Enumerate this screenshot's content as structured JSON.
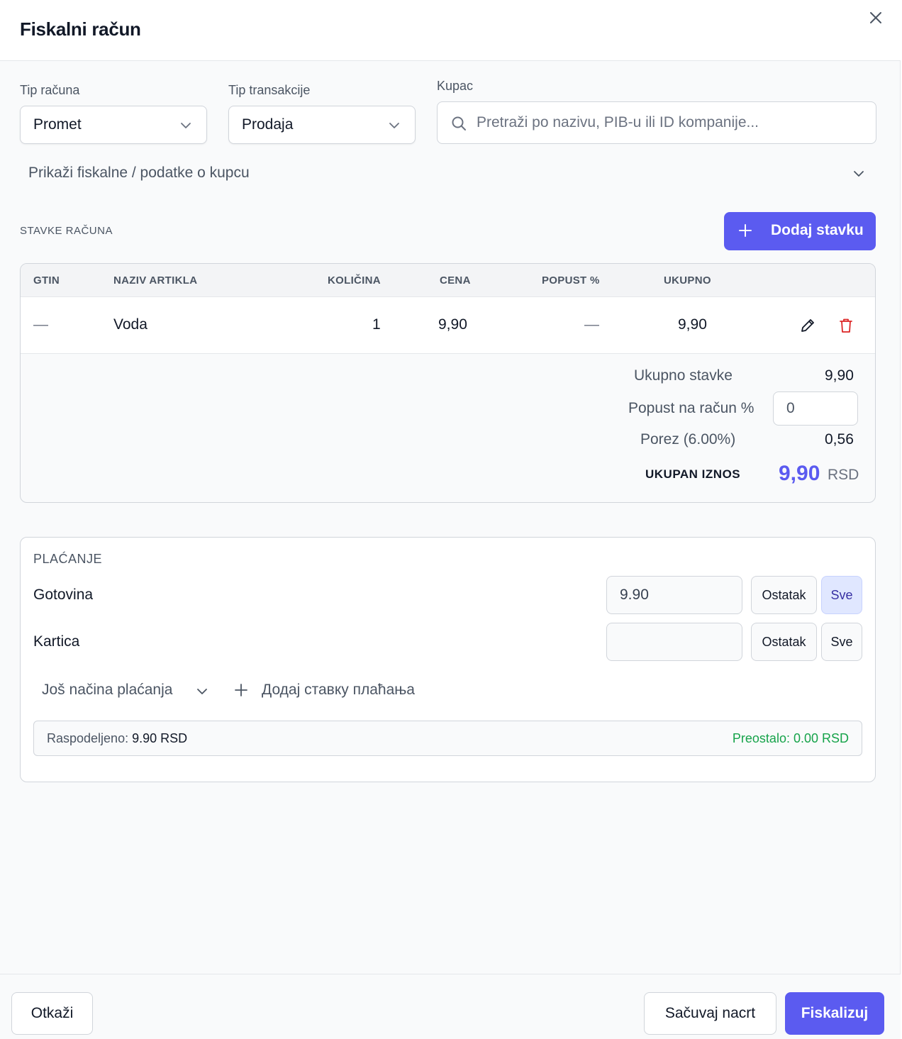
{
  "header": {
    "title": "Fiskalni račun",
    "close_icon": "close-icon"
  },
  "form": {
    "tip_racuna": {
      "label": "Tip računa",
      "value": "Promet"
    },
    "tip_transakcije": {
      "label": "Tip transakcije",
      "value": "Prodaja"
    },
    "kupac": {
      "label": "Kupac",
      "placeholder": "Pretraži po nazivu, PIB-u ili ID kompanije..."
    },
    "toggle_label": "Prikaži fiskalne / podatke o kupcu"
  },
  "items": {
    "section_title": "STAVKE RAČUNA",
    "add_button": "Dodaj stavku",
    "columns": [
      "GTIN",
      "NAZIV ARTIKLA",
      "KOLIČINA",
      "CENA",
      "POPUST %",
      "UKUPNO"
    ],
    "rows": [
      {
        "gtin": "—",
        "name": "Voda",
        "qty": "1",
        "price": "9,90",
        "discount": "—",
        "total": "9,90"
      }
    ]
  },
  "summary": {
    "items_total_label": "Ukupno stavke",
    "items_total_value": "9,90",
    "discount_label": "Popust na račun %",
    "discount_value": "0",
    "tax_label": "Porez (6.00%)",
    "tax_value": "0,56",
    "grand_total_label": "UKUPAN IZNOS",
    "grand_total_value": "9,90",
    "currency": "RSD"
  },
  "payment": {
    "title": "PLAĆANJE",
    "methods": [
      {
        "label": "Gotovina",
        "amount": "9.90",
        "remainder_btn": "Ostatak",
        "all_btn": "Sve"
      },
      {
        "label": "Kartica",
        "amount": "",
        "remainder_btn": "Ostatak",
        "all_btn": "Sve"
      }
    ],
    "more_methods": "Još načina plaćanja",
    "add_payment": "Додај ставку плаћања",
    "allocated_label": "Raspodeljeno:",
    "allocated_value": "9.90 RSD",
    "remaining": "Preostalo: 0.00 RSD"
  },
  "footer": {
    "cancel": "Otkaži",
    "save_draft": "Sačuvaj nacrt",
    "fiscalize": "Fiskalizuj"
  },
  "colors": {
    "accent": "#5b5bf0",
    "danger": "#dc2626",
    "success": "#16a34a"
  }
}
